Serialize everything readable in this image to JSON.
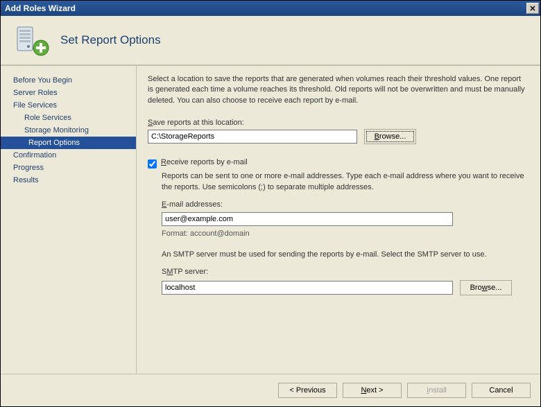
{
  "window": {
    "title": "Add Roles Wizard",
    "close": "✕"
  },
  "header": {
    "title": "Set Report Options"
  },
  "nav": {
    "items": [
      {
        "label": "Before You Begin",
        "indent": 0
      },
      {
        "label": "Server Roles",
        "indent": 0
      },
      {
        "label": "File Services",
        "indent": 0
      },
      {
        "label": "Role Services",
        "indent": 1
      },
      {
        "label": "Storage Monitoring",
        "indent": 1
      },
      {
        "label": "Report Options",
        "indent": 2,
        "selected": true
      },
      {
        "label": "Confirmation",
        "indent": 0
      },
      {
        "label": "Progress",
        "indent": 0
      },
      {
        "label": "Results",
        "indent": 0
      }
    ]
  },
  "content": {
    "description": "Select a location to save the reports that are generated when volumes reach their threshold values. One report is generated each time a volume reaches its threshold. Old reports will not be overwritten and must be manually deleted. You can also choose to receive each report by e-mail.",
    "save_label": "Save reports at this location:",
    "save_value": "C:\\StorageReports",
    "browse1": "Browse...",
    "receive_checked": true,
    "receive_label": "Receive reports by e-mail",
    "receive_desc": "Reports can be sent to one or more e-mail addresses. Type each e-mail address where you want to receive the reports. Use semicolons (;) to separate multiple addresses.",
    "email_label": "E-mail addresses:",
    "email_value": "user@example.com",
    "format_hint": "Format: account@domain",
    "smtp_desc": "An SMTP server must be used for sending the reports by e-mail. Select the SMTP server to use.",
    "smtp_label": "SMTP server:",
    "smtp_value": "localhost",
    "browse2": "Browse..."
  },
  "footer": {
    "previous": "< Previous",
    "next": "Next >",
    "install": "Install",
    "cancel": "Cancel"
  }
}
